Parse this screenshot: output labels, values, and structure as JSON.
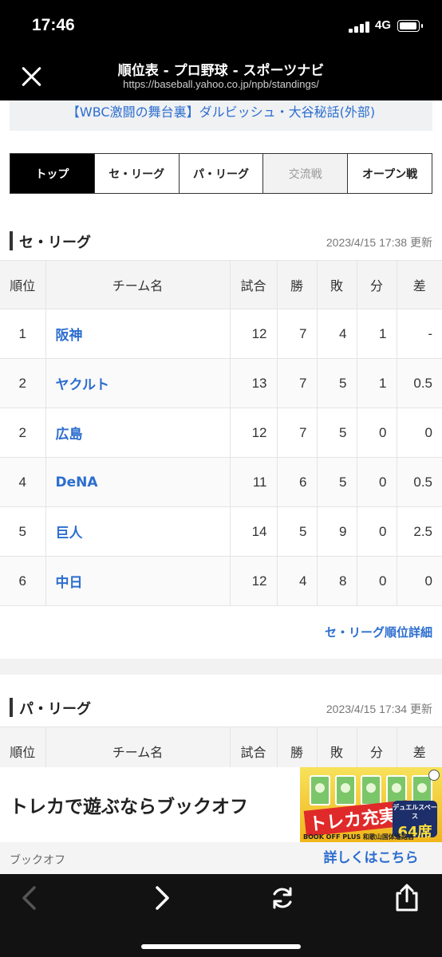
{
  "status_bar": {
    "time": "17:46",
    "network": "4G",
    "battery_percent": 90
  },
  "browser": {
    "title": "順位表 - プロ野球 - スポーツナビ",
    "url": "https://baseball.yahoo.co.jp/npb/standings/"
  },
  "news_banner": {
    "text": "【WBC激闘の舞台裏】ダルビッシュ・大谷秘話(外部)"
  },
  "tabs": [
    {
      "label": "トップ",
      "state": "active"
    },
    {
      "label": "セ・リーグ",
      "state": "normal"
    },
    {
      "label": "パ・リーグ",
      "state": "normal"
    },
    {
      "label": "交流戦",
      "state": "disabled"
    },
    {
      "label": "オープン戦",
      "state": "normal"
    }
  ],
  "columns": [
    "順位",
    "チーム名",
    "試合",
    "勝",
    "敗",
    "分",
    "差"
  ],
  "central_league": {
    "title": "セ・リーグ",
    "updated": "2023/4/15 17:38 更新",
    "rows": [
      {
        "rank": "1",
        "team": "阪神",
        "games": "12",
        "wins": "7",
        "losses": "4",
        "draws": "1",
        "gb": "-"
      },
      {
        "rank": "2",
        "team": "ヤクルト",
        "games": "13",
        "wins": "7",
        "losses": "5",
        "draws": "1",
        "gb": "0.5"
      },
      {
        "rank": "2",
        "team": "広島",
        "games": "12",
        "wins": "7",
        "losses": "5",
        "draws": "0",
        "gb": "0"
      },
      {
        "rank": "4",
        "team": "DeNA",
        "games": "11",
        "wins": "6",
        "losses": "5",
        "draws": "0",
        "gb": "0.5"
      },
      {
        "rank": "5",
        "team": "巨人",
        "games": "14",
        "wins": "5",
        "losses": "9",
        "draws": "0",
        "gb": "2.5"
      },
      {
        "rank": "6",
        "team": "中日",
        "games": "12",
        "wins": "4",
        "losses": "8",
        "draws": "0",
        "gb": "0"
      }
    ],
    "detail_link": "セ・リーグ順位詳細"
  },
  "pacific_league": {
    "title": "パ・リーグ",
    "updated": "2023/4/15 17:34 更新"
  },
  "ad": {
    "headline": "トレカで遊ぶならブックオフ",
    "advertiser": "ブックオフ",
    "cta": "詳しくはこちら",
    "image_text": "トレカ充実!",
    "image_seats_top": "デュエルスペース",
    "image_seats": "64席",
    "image_store": "BOOK OFF PLUS 和歌山国体道路店"
  },
  "toolbar_icons": [
    "back-icon",
    "forward-icon",
    "reload-icon",
    "share-icon"
  ]
}
